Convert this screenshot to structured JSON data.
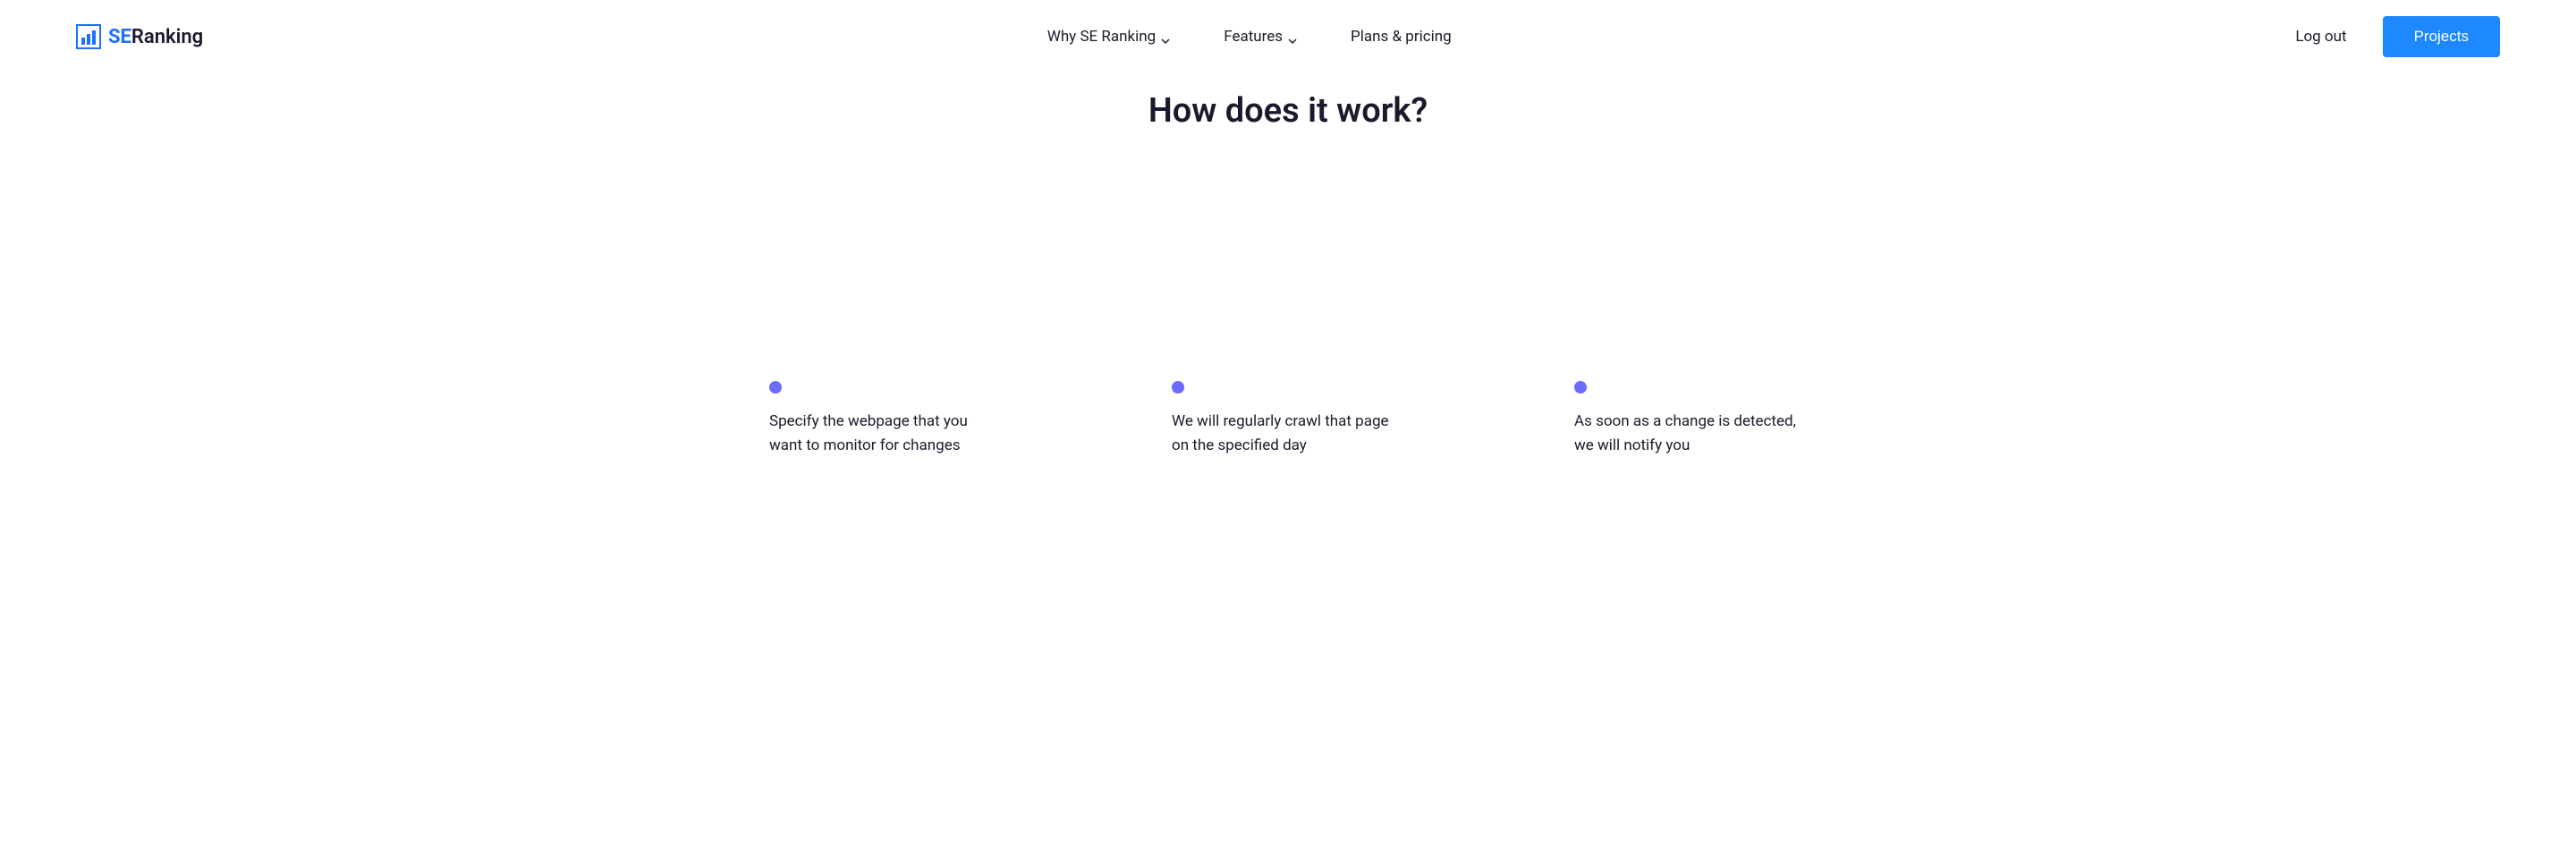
{
  "header": {
    "logo": {
      "text_se": "SE",
      "text_ranking": "Ranking"
    },
    "nav": [
      {
        "label": "Why SE Ranking",
        "has_dropdown": true
      },
      {
        "label": "Features",
        "has_dropdown": true
      },
      {
        "label": "Plans & pricing",
        "has_dropdown": false
      }
    ],
    "logout": "Log out",
    "projects_button": "Projects"
  },
  "main": {
    "title": "How does it work?",
    "steps": [
      {
        "text": "Specify the webpage that you want to monitor for changes"
      },
      {
        "text": "We will regularly crawl that page on the specified day"
      },
      {
        "text": "As soon as a change is detected, we will notify you"
      }
    ]
  }
}
